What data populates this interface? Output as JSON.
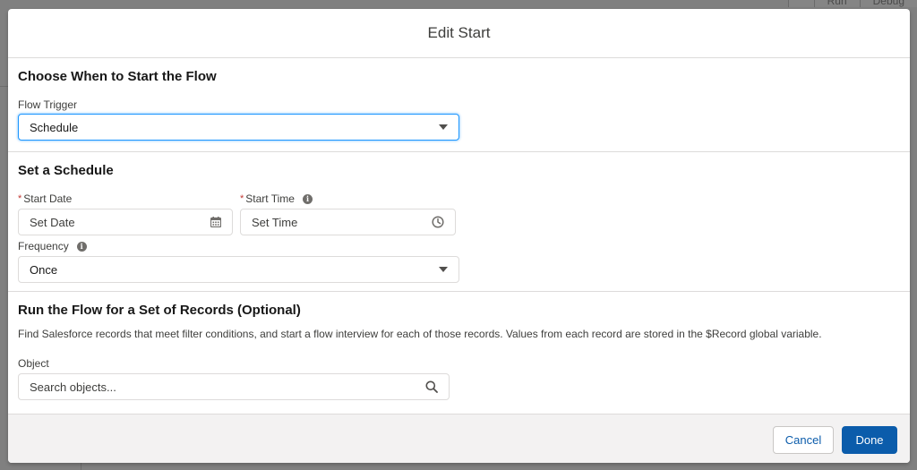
{
  "background": {
    "top_buttons": [
      "",
      "Run",
      "Debug"
    ]
  },
  "modal": {
    "title": "Edit Start"
  },
  "trigger_section": {
    "title": "Choose When to Start the Flow",
    "flow_trigger_label": "Flow Trigger",
    "flow_trigger_value": "Schedule"
  },
  "schedule_section": {
    "title": "Set a Schedule",
    "start_date_label": "Start Date",
    "start_date_placeholder": "Set Date",
    "start_time_label": "Start Time",
    "start_time_placeholder": "Set Time",
    "frequency_label": "Frequency",
    "frequency_value": "Once",
    "required_marker": "*",
    "info_glyph": "i"
  },
  "records_section": {
    "title": "Run the Flow for a Set of Records (Optional)",
    "description": "Find Salesforce records that meet filter conditions, and start a flow interview for each of those records. Values from each record are stored in the $Record global variable.",
    "object_label": "Object",
    "object_placeholder": "Search objects..."
  },
  "footer": {
    "cancel_label": "Cancel",
    "done_label": "Done"
  },
  "icons": {
    "calendar": "calendar-icon",
    "clock": "clock-icon",
    "search": "search-icon",
    "info": "info-icon",
    "dropdown": "chevron-down-icon"
  },
  "colors": {
    "brand": "#0b5cab",
    "focus_border": "#1b96ff",
    "required": "#c23934",
    "border": "#dddbda",
    "footer_bg": "#f3f2f2"
  }
}
